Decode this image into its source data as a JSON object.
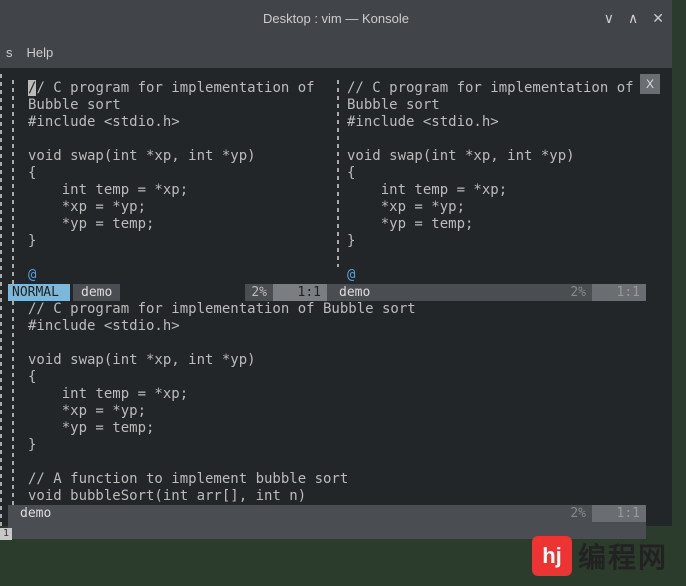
{
  "titlebar": "Desktop : vim — Konsole",
  "menu": {
    "left": "s",
    "help": "Help"
  },
  "close_tab": "X",
  "panes": {
    "top_left": {
      "lines": "// C program for implementation of\nBubble sort\n#include <stdio.h>\n\nvoid swap(int *xp, int *yp)\n{\n    int temp = *xp;\n    *xp = *yp;\n    *yp = temp;\n}\n",
      "cursor_char": "/",
      "at": "@",
      "status": {
        "mode": "NORMAL",
        "file": "demo",
        "pct": "2%",
        "pos": "1:1"
      }
    },
    "top_right": {
      "lines": "// C program for implementation of\nBubble sort\n#include <stdio.h>\n\nvoid swap(int *xp, int *yp)\n{\n    int temp = *xp;\n    *xp = *yp;\n    *yp = temp;\n}\n",
      "at": "@",
      "status": {
        "file": "demo",
        "pct": "2%",
        "pos": "1:1"
      }
    },
    "bottom": {
      "lines": "// C program for implementation of Bubble sort\n#include <stdio.h>\n\nvoid swap(int *xp, int *yp)\n{\n    int temp = *xp;\n    *xp = *yp;\n    *yp = temp;\n}\n\n// A function to implement bubble sort\nvoid bubbleSort(int arr[], int n)",
      "status": {
        "file": "demo",
        "pct": "2%",
        "pos": "1:1"
      }
    }
  },
  "ruler_num": "1",
  "logo": {
    "mark": "hj",
    "text": "编程网"
  }
}
